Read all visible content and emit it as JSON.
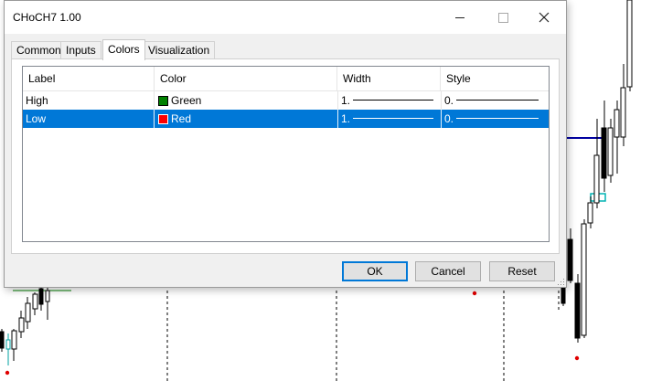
{
  "window": {
    "title": "CHoCH7 1.00"
  },
  "tabs": [
    {
      "label": "Common"
    },
    {
      "label": "Inputs"
    },
    {
      "label": "Colors",
      "active": true
    },
    {
      "label": "Visualization"
    }
  ],
  "columns": {
    "label": "Label",
    "color": "Color",
    "width": "Width",
    "style": "Style"
  },
  "rows": [
    {
      "label": "High",
      "color_name": "Green",
      "color_hex": "#008000",
      "width": "1.",
      "style": "0.",
      "selected": false
    },
    {
      "label": "Low",
      "color_name": "Red",
      "color_hex": "#ff0000",
      "width": "1.",
      "style": "0.",
      "selected": true
    }
  ],
  "buttons": {
    "ok": "OK",
    "cancel": "Cancel",
    "reset": "Reset"
  },
  "colors": {
    "selection": "#0078d7",
    "chart_level_line": "#0000a0",
    "chart_signal_dot": "#e00000",
    "chart_box": "#00b3b3",
    "chart_hline": "#008000"
  }
}
